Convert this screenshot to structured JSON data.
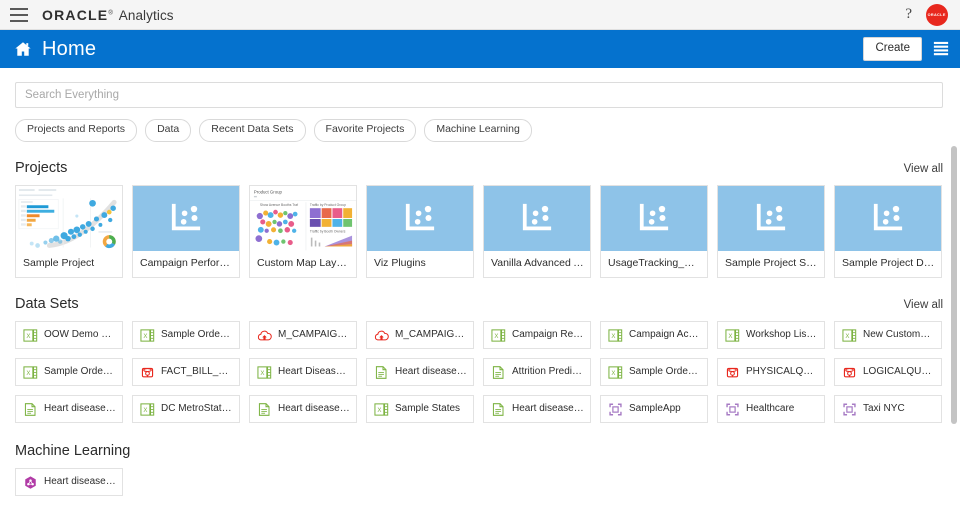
{
  "topbar": {
    "menu_icon": "hamburger-icon",
    "brand": "ORACLE",
    "brand_trademark": "®",
    "brand_sub": "Analytics",
    "help_label": "?",
    "avatar_label": "ORACLE"
  },
  "header": {
    "home_icon": "home-icon",
    "title": "Home",
    "create_label": "Create",
    "listview_icon": "list-view-icon"
  },
  "search": {
    "placeholder": "Search Everything",
    "value": ""
  },
  "filters": [
    {
      "label": "Projects and Reports"
    },
    {
      "label": "Data"
    },
    {
      "label": "Recent Data Sets"
    },
    {
      "label": "Favorite Projects"
    },
    {
      "label": "Machine Learning"
    }
  ],
  "projects": {
    "title": "Projects",
    "view_all": "View all",
    "items": [
      {
        "label": "Sample Project",
        "thumb": "dashboard-scatter"
      },
      {
        "label": "Campaign Performance ...",
        "thumb": "placeholder"
      },
      {
        "label": "Custom Map Layers",
        "thumb": "dashboard-map"
      },
      {
        "label": "Viz Plugins",
        "thumb": "placeholder"
      },
      {
        "label": "Vanilla Advanced Analytics",
        "thumb": "placeholder"
      },
      {
        "label": "UsageTracking_Sample",
        "thumb": "placeholder"
      },
      {
        "label": "Sample Project SA Based",
        "thumb": "placeholder"
      },
      {
        "label": "Sample Project DB Based",
        "thumb": "placeholder"
      }
    ]
  },
  "datasets": {
    "title": "Data Sets",
    "view_all": "View all",
    "rows": [
      [
        {
          "label": "OOW Demo Booth...",
          "icon": "excel-icon"
        },
        {
          "label": "Sample Orders R E...",
          "icon": "excel-icon"
        },
        {
          "label": "M_CAMPAIGN_RE...",
          "icon": "cloud-icon"
        },
        {
          "label": "M_CAMPAIGN_AC...",
          "icon": "cloud-icon"
        },
        {
          "label": "Campaign Revenue",
          "icon": "excel-icon"
        },
        {
          "label": "Campaign Activity",
          "icon": "excel-icon"
        },
        {
          "label": "Workshop List Aug...",
          "icon": "excel-icon"
        },
        {
          "label": "New Customers Pr...",
          "icon": "excel-icon"
        }
      ],
      [
        {
          "label": "Sample Order Lines",
          "icon": "excel-icon"
        },
        {
          "label": "FACT_BILL_REV_S...",
          "icon": "database-icon"
        },
        {
          "label": "Heart Disease likel...",
          "icon": "excel-icon"
        },
        {
          "label": "Heart disease likel...",
          "icon": "file-icon"
        },
        {
          "label": "Attrition Predicted ...",
          "icon": "file-icon"
        },
        {
          "label": "Sample Orders R E...",
          "icon": "excel-icon"
        },
        {
          "label": "PHYSICALQUERIE...",
          "icon": "database-icon"
        },
        {
          "label": "LOGICALQUERIES...",
          "icon": "database-icon"
        }
      ],
      [
        {
          "label": "Heart disease likel...",
          "icon": "file-icon"
        },
        {
          "label": "DC MetroStationsL...",
          "icon": "excel-icon"
        },
        {
          "label": "Heart disease likel...",
          "icon": "file-icon"
        },
        {
          "label": "Sample States",
          "icon": "excel-icon"
        },
        {
          "label": "Heart disease likel...",
          "icon": "file-icon"
        },
        {
          "label": "SampleApp",
          "icon": "subject-area-icon"
        },
        {
          "label": "Healthcare",
          "icon": "subject-area-icon"
        },
        {
          "label": "Taxi NYC",
          "icon": "subject-area-icon"
        }
      ]
    ]
  },
  "machine_learning": {
    "title": "Machine Learning",
    "items": [
      {
        "label": "Heart disease likel...",
        "icon": "ml-model-icon"
      }
    ]
  },
  "colors": {
    "brand_blue": "#0572ce",
    "thumb_blue": "#8ec3e8",
    "avatar_red": "#e8281e",
    "excel_green": "#7cb342",
    "cloud_red": "#e8281e",
    "database_red": "#e8281e",
    "subject_purple": "#a77bc4",
    "ml_purple": "#b13ba6"
  }
}
